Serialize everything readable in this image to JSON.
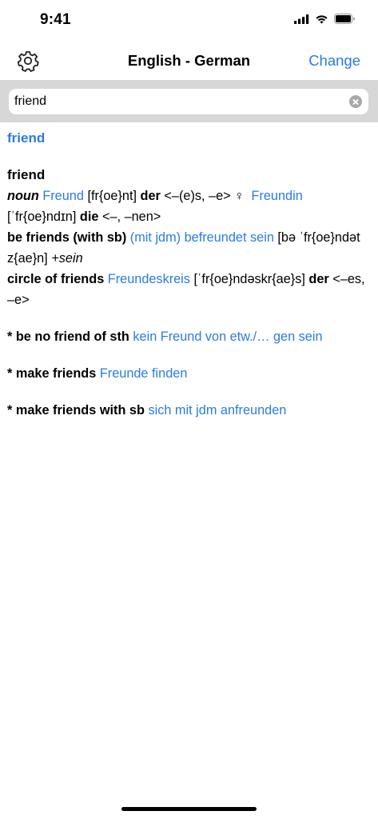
{
  "status_bar": {
    "time": "9:41"
  },
  "nav": {
    "title": "English - German",
    "change_label": "Change",
    "settings_icon": "gear-icon"
  },
  "search": {
    "value": "friend",
    "clear_icon": "clear-circle-icon"
  },
  "result": {
    "headword_link": "friend",
    "entry_headword": "friend",
    "sense_noun": {
      "pos": "noun",
      "translation": "Freund",
      "phonetic": "[fr{oe}nt]",
      "gender": "der",
      "inflection": "<–(e)s, –e>",
      "female_symbol": "♀",
      "translation_f": "Freundin",
      "phonetic_f": "[ˈfr{oe}ndɪn]",
      "gender_f": "die",
      "inflection_f": "<–, –nen>"
    },
    "phrase_be_friends": {
      "phrase": "be friends (with sb)",
      "translation": "(mit jdm) befreundet sein",
      "phonetic": "[bə ˈfr{oe}ndət z{ae}n]",
      "note": "+sein"
    },
    "phrase_circle": {
      "phrase": "circle of friends",
      "translation": "Freundeskreis",
      "phonetic": "[ˈfr{oe}ndəskr{ae}s]",
      "gender": "der",
      "inflection": "<–es, –e>"
    },
    "idioms": [
      {
        "phrase": "* be no friend of sth",
        "translation": "kein Freund von etw./… gen sein"
      },
      {
        "phrase": "* make friends",
        "translation": "Freunde finden"
      },
      {
        "phrase": "* make friends with sb",
        "translation": "sich mit jdm anfreunden"
      }
    ]
  },
  "colors": {
    "accent": "#2a7be4",
    "search_bar_bg": "#d7d7d7"
  }
}
